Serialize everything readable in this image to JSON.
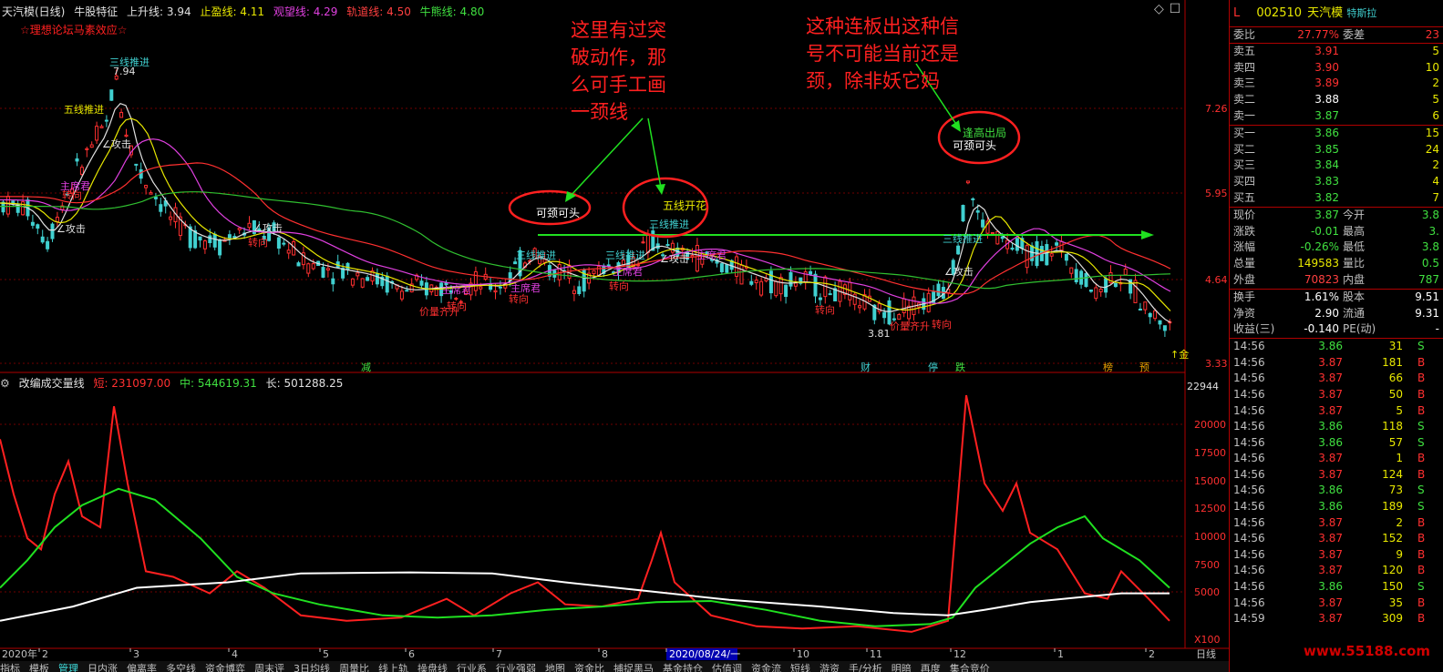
{
  "header": {
    "title": "天汽模(日线)",
    "indicator": "牛股特征",
    "items": [
      {
        "label": "上升线: 3.94",
        "color": "#e0e0e0"
      },
      {
        "label": "止盈线: 4.11",
        "color": "#e8e800"
      },
      {
        "label": "观望线: 4.29",
        "color": "#e040e0"
      },
      {
        "label": "轨道线: 4.50",
        "color": "#ff4040"
      },
      {
        "label": "牛熊线: 4.80",
        "color": "#40e040"
      }
    ],
    "forum": "☆理想论坛马素效应☆"
  },
  "price_axis": [
    "7.26",
    "5.95",
    "4.64",
    "3.33"
  ],
  "volume_axis": [
    "22944",
    "20000",
    "17500",
    "15000",
    "12500",
    "10000",
    "7500",
    "5000",
    "X100"
  ],
  "annotations": {
    "note1": [
      "这里有过突",
      "破动作，那",
      "么可手工画",
      "一颈线"
    ],
    "note2": [
      "这种连板出这种信",
      "号不可能当前还是",
      "颈，除非妖它妈"
    ],
    "circle1": "可颈可头",
    "circle2": "五线开花",
    "circle3_top": "逢高出局",
    "circle3_bottom": "可颈可头"
  },
  "signals": {
    "sanxian": "三线推进",
    "wuxian": "五线推进",
    "gongji": "∠攻击",
    "zhuanxiang": "转向",
    "jiaqiang": "价量齐升",
    "zhuangjia": "主席君",
    "high_price": "7.94",
    "low_price": "3.81"
  },
  "events": [
    "减",
    "财",
    "停",
    "跌",
    "榜",
    "预"
  ],
  "event_right": "↑金",
  "sub_header": {
    "title": "改编成交量线",
    "short": "短: 231097.00",
    "mid": "中: 544619.31",
    "long": "长: 501288.25"
  },
  "time_axis": [
    "2020年",
    "2",
    "3",
    "4",
    "5",
    "6",
    "7",
    "8",
    "2020/08/24/一",
    "10",
    "11",
    "12",
    "1",
    "2",
    "日线"
  ],
  "bottom_tabs": [
    "指标",
    "模板",
    "管理",
    "日内涨",
    "偏离率",
    "多空线",
    "资金博弈",
    "周末评",
    "3日均线",
    "周量比",
    "线上轨",
    "操盘线",
    "行业系",
    "行业强弱",
    "地图",
    "资金比",
    "捕捉黑马",
    "基金持仓",
    "估值调",
    "资金流",
    "短线",
    "游资",
    "手/分析",
    "明暗",
    "再度",
    "集合竞价"
  ],
  "quote": {
    "badge": "L",
    "code": "002510",
    "name": "天汽模",
    "tag": "特斯拉",
    "weibi_label": "委比",
    "weibi": "27.77%",
    "weicha_label": "委差",
    "weicha": "23",
    "sells": [
      {
        "label": "卖五",
        "price": "3.91",
        "vol": "5"
      },
      {
        "label": "卖四",
        "price": "3.90",
        "vol": "10"
      },
      {
        "label": "卖三",
        "price": "3.89",
        "vol": "2"
      },
      {
        "label": "卖二",
        "price": "3.88",
        "vol": "5"
      },
      {
        "label": "卖一",
        "price": "3.87",
        "vol": "6"
      }
    ],
    "buys": [
      {
        "label": "买一",
        "price": "3.86",
        "vol": "15"
      },
      {
        "label": "买二",
        "price": "3.85",
        "vol": "24"
      },
      {
        "label": "买三",
        "price": "3.84",
        "vol": "2"
      },
      {
        "label": "买四",
        "price": "3.83",
        "vol": "4"
      },
      {
        "label": "买五",
        "price": "3.82",
        "vol": "7"
      }
    ],
    "stats": [
      {
        "l1": "现价",
        "v1": "3.87",
        "c1": "#40e040",
        "l2": "今开",
        "v2": "3.8"
      },
      {
        "l1": "涨跌",
        "v1": "-0.01",
        "c1": "#40e040",
        "l2": "最高",
        "v2": "3."
      },
      {
        "l1": "涨幅",
        "v1": "-0.26%",
        "c1": "#40e040",
        "l2": "最低",
        "v2": "3.8"
      },
      {
        "l1": "总量",
        "v1": "149583",
        "c1": "#e8e800",
        "l2": "量比",
        "v2": "0.5"
      },
      {
        "l1": "外盘",
        "v1": "70823",
        "c1": "#ff4040",
        "l2": "内盘",
        "v2": "787"
      }
    ],
    "stats2": [
      {
        "l1": "换手",
        "v1": "1.61%",
        "l2": "股本",
        "v2": "9.51"
      },
      {
        "l1": "净资",
        "v1": "2.90",
        "l2": "流通",
        "v2": "9.31"
      },
      {
        "l1": "收益(三)",
        "v1": "-0.140",
        "l2": "PE(动)",
        "v2": "-"
      }
    ],
    "ticks": [
      {
        "t": "14:56",
        "p": "3.86",
        "v": "31",
        "bs": "S"
      },
      {
        "t": "14:56",
        "p": "3.87",
        "v": "181",
        "bs": "B"
      },
      {
        "t": "14:56",
        "p": "3.87",
        "v": "66",
        "bs": "B"
      },
      {
        "t": "14:56",
        "p": "3.87",
        "v": "50",
        "bs": "B"
      },
      {
        "t": "14:56",
        "p": "3.87",
        "v": "5",
        "bs": "B"
      },
      {
        "t": "14:56",
        "p": "3.86",
        "v": "118",
        "bs": "S"
      },
      {
        "t": "14:56",
        "p": "3.86",
        "v": "57",
        "bs": "S"
      },
      {
        "t": "14:56",
        "p": "3.87",
        "v": "1",
        "bs": "B"
      },
      {
        "t": "14:56",
        "p": "3.87",
        "v": "124",
        "bs": "B"
      },
      {
        "t": "14:56",
        "p": "3.86",
        "v": "73",
        "bs": "S"
      },
      {
        "t": "14:56",
        "p": "3.86",
        "v": "189",
        "bs": "S"
      },
      {
        "t": "14:56",
        "p": "3.87",
        "v": "2",
        "bs": "B"
      },
      {
        "t": "14:56",
        "p": "3.87",
        "v": "152",
        "bs": "B"
      },
      {
        "t": "14:56",
        "p": "3.87",
        "v": "9",
        "bs": "B"
      },
      {
        "t": "14:56",
        "p": "3.87",
        "v": "120",
        "bs": "B"
      },
      {
        "t": "14:56",
        "p": "3.86",
        "v": "150",
        "bs": "S"
      },
      {
        "t": "14:56",
        "p": "3.87",
        "v": "35",
        "bs": "B"
      },
      {
        "t": "14:59",
        "p": "3.87",
        "v": "309",
        "bs": "B"
      }
    ]
  },
  "watermark": "www.55188.com",
  "colors": {
    "up": "#ff3030",
    "down": "#40d0d0",
    "ma_white": "#e0e0e0",
    "ma_yellow": "#e8e800",
    "ma_magenta": "#e040e0",
    "ma_red": "#ff3030",
    "ma_green": "#30c030",
    "arrow_green": "#20e020",
    "annotation_red": "#ff2020"
  }
}
